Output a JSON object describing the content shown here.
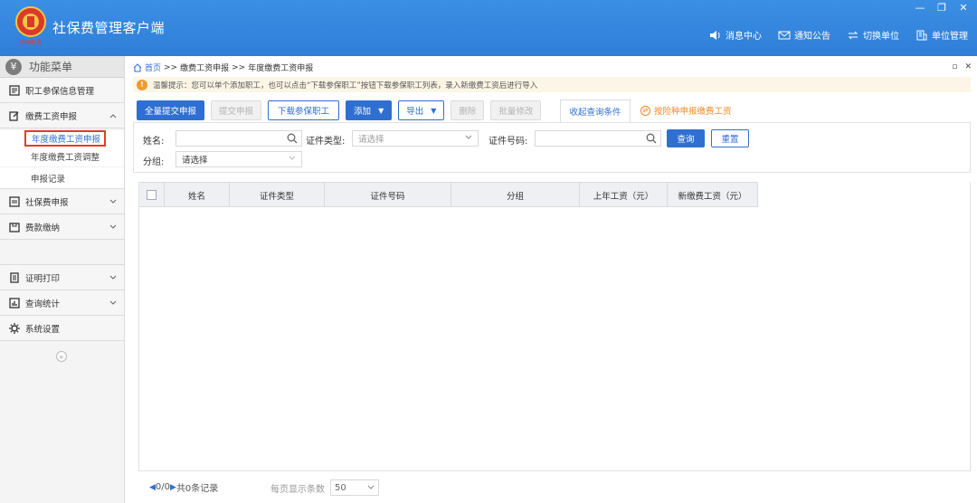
{
  "app": {
    "title": "社保费管理客户端",
    "logo_text": "中国税务"
  },
  "window_controls": [
    "—",
    "❐",
    "✕"
  ],
  "header_nav": [
    {
      "label": "消息中心",
      "icon": "speaker-icon"
    },
    {
      "label": "通知公告",
      "icon": "mail-icon"
    },
    {
      "label": "切换单位",
      "icon": "switch-icon"
    },
    {
      "label": "单位管理",
      "icon": "building-icon"
    }
  ],
  "sidebar": {
    "title": "功能菜单",
    "title_icon": "¥",
    "items": [
      {
        "label": "职工参保信息管理",
        "icon": "user-card-icon"
      },
      {
        "label": "缴费工资申报",
        "icon": "edit-icon",
        "expanded": true,
        "children": [
          "年度缴费工资申报",
          "年度缴费工资调整",
          "申报记录"
        ],
        "active_child": 0
      },
      {
        "label": "社保费申报",
        "icon": "form-icon"
      },
      {
        "label": "费款缴纳",
        "icon": "wallet-icon"
      },
      {
        "label": "证明打印",
        "icon": "print-icon"
      },
      {
        "label": "查询统计",
        "icon": "chart-icon"
      },
      {
        "label": "系统设置",
        "icon": "gear-icon"
      }
    ],
    "collapse_glyph": "«"
  },
  "breadcrumb": {
    "home": "首页",
    "sep": ">>",
    "parts": [
      "缴费工资申报",
      "年度缴费工资申报"
    ]
  },
  "panel_controls": [
    "▫",
    "✕"
  ],
  "tip": {
    "text": "温馨提示：您可以单个添加职工，也可以点击“下载参保职工”按钮下载参保职工列表，录入新缴费工资后进行导入"
  },
  "toolbar": {
    "submit_all": "全量提交申报",
    "submit": "提交申报",
    "download": "下载参保职工",
    "add": "添加",
    "export": "导出",
    "delete": "删除",
    "batch_edit": "批量修改",
    "collapse_query": "收起查询条件",
    "by_insurance": "按险种申报缴费工资"
  },
  "query": {
    "name_label": "姓名:",
    "name_value": "",
    "id_type_label": "证件类型:",
    "id_type_placeholder": "请选择",
    "id_no_label": "证件号码:",
    "id_no_value": "",
    "group_label": "分组:",
    "group_value": "请选择",
    "search": "查询",
    "reset": "重置"
  },
  "table": {
    "columns": [
      "姓名",
      "证件类型",
      "证件号码",
      "分组",
      "上年工资（元）",
      "新缴费工资（元）"
    ],
    "rows": []
  },
  "pager": {
    "prev": "◀",
    "page": "0/0",
    "next": "▶",
    "total": "共0条记录",
    "per_page_label": "每页显示条数",
    "per_page_value": "50"
  },
  "colors": {
    "header": "#2f7ed8",
    "primary": "#2f6fd1",
    "highlight_box": "#e23b2f",
    "orange": "#f08a24"
  }
}
